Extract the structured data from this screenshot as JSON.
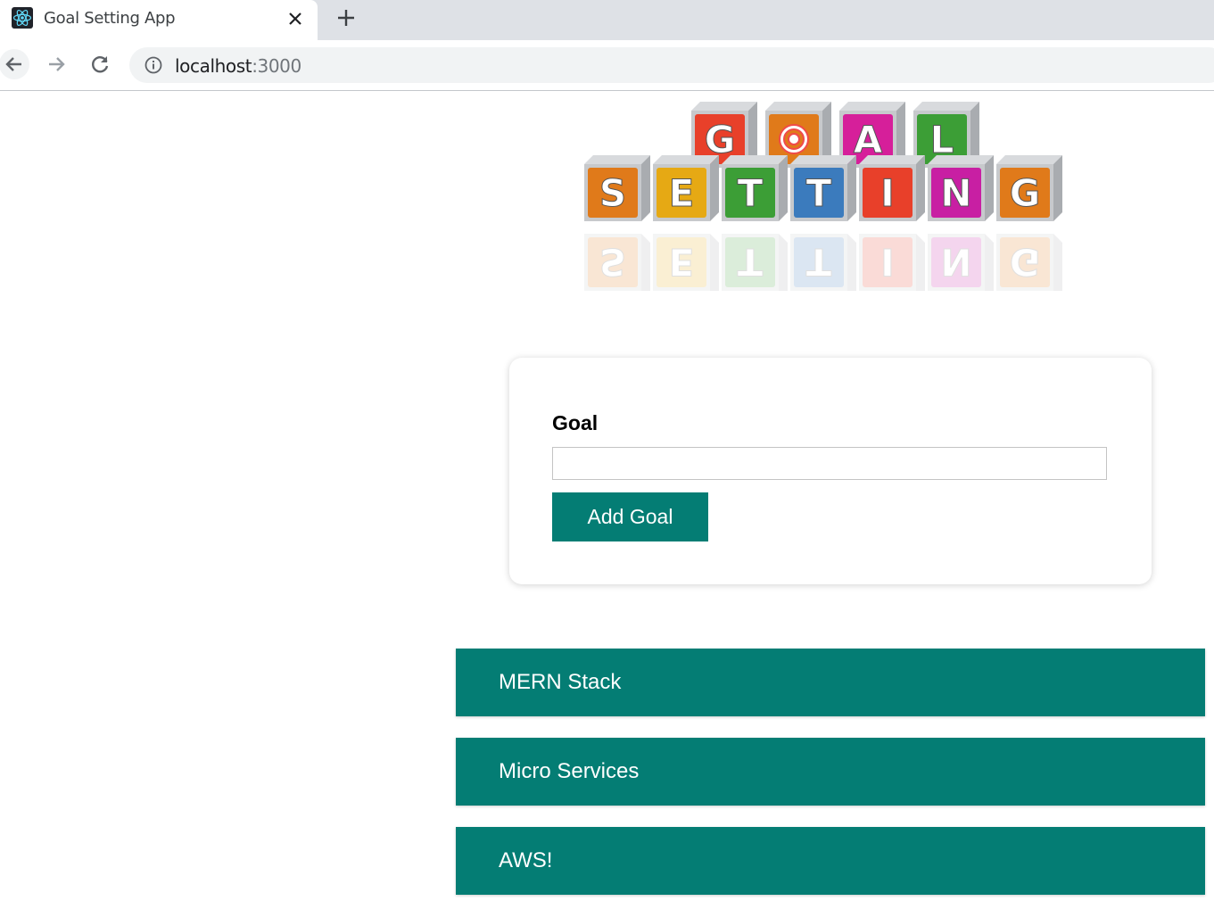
{
  "browser": {
    "tab_title": "Goal Setting App",
    "favicon": "react-logo-icon",
    "url_host": "localhost",
    "url_port": ":3000"
  },
  "logo": {
    "top_letters": [
      "G",
      "◎",
      "A",
      "L"
    ],
    "bottom_letters": [
      "S",
      "E",
      "T",
      "T",
      "I",
      "N",
      "G"
    ],
    "alt": "GOAL SETTING"
  },
  "form": {
    "label": "Goal",
    "input_value": "",
    "placeholder": "",
    "button_label": "Add Goal"
  },
  "goals": [
    {
      "text": "MERN Stack"
    },
    {
      "text": "Micro Services"
    },
    {
      "text": "AWS!"
    }
  ],
  "colors": {
    "accent": "#047d74",
    "tabstrip": "#dee1e6"
  }
}
